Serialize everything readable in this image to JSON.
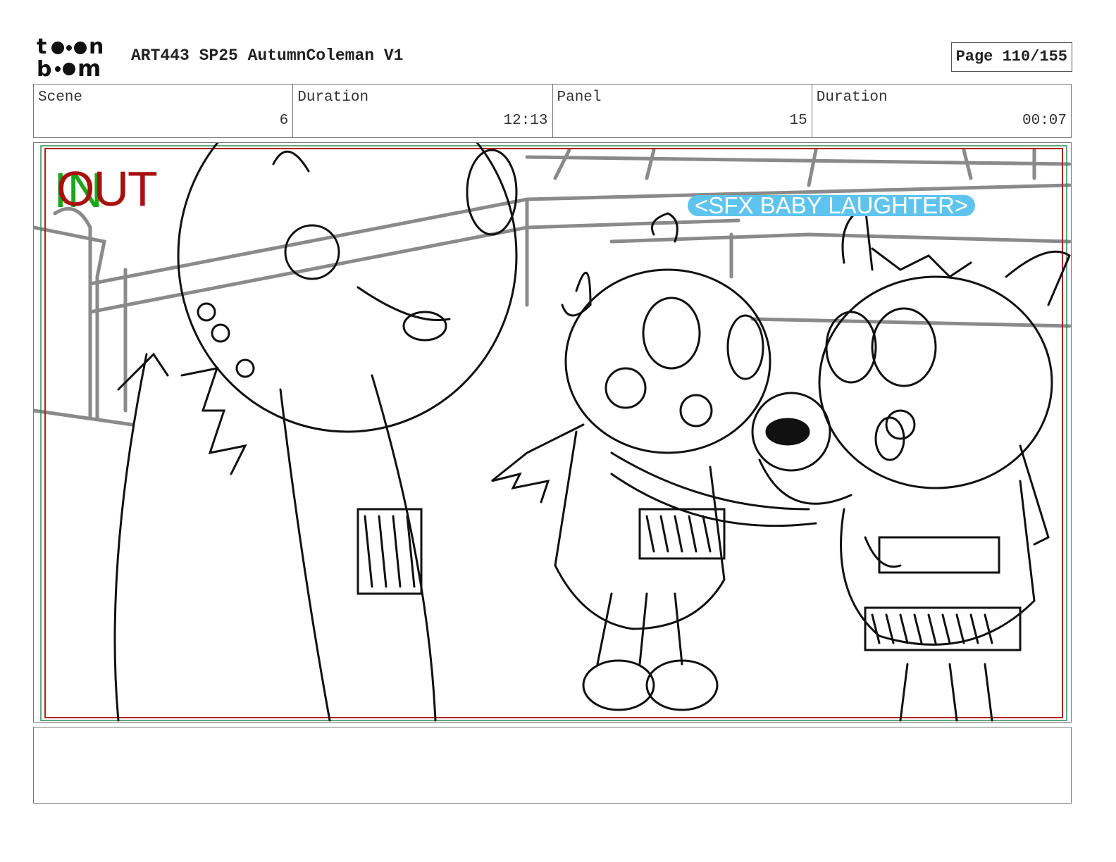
{
  "header": {
    "logo_text": "toon boom",
    "title": "ART443 SP25 AutumnColeman V1",
    "page_label": "Page 110/155"
  },
  "info": {
    "scene_label": "Scene",
    "scene_value": "6",
    "scene_duration_label": "Duration",
    "scene_duration_value": "12:13",
    "panel_label": "Panel",
    "panel_value": "15",
    "panel_duration_label": "Duration",
    "panel_duration_value": "00:07"
  },
  "panel": {
    "in_label": "IN",
    "out_label": "OUT",
    "sfx_text": "<SFX BABY LAUGHTER>"
  },
  "notes": {
    "text": ""
  },
  "colors": {
    "in_green": "#1aa81a",
    "out_red": "#a81010",
    "sfx_blue": "#5ec4ee",
    "frame_gray": "#777777"
  }
}
